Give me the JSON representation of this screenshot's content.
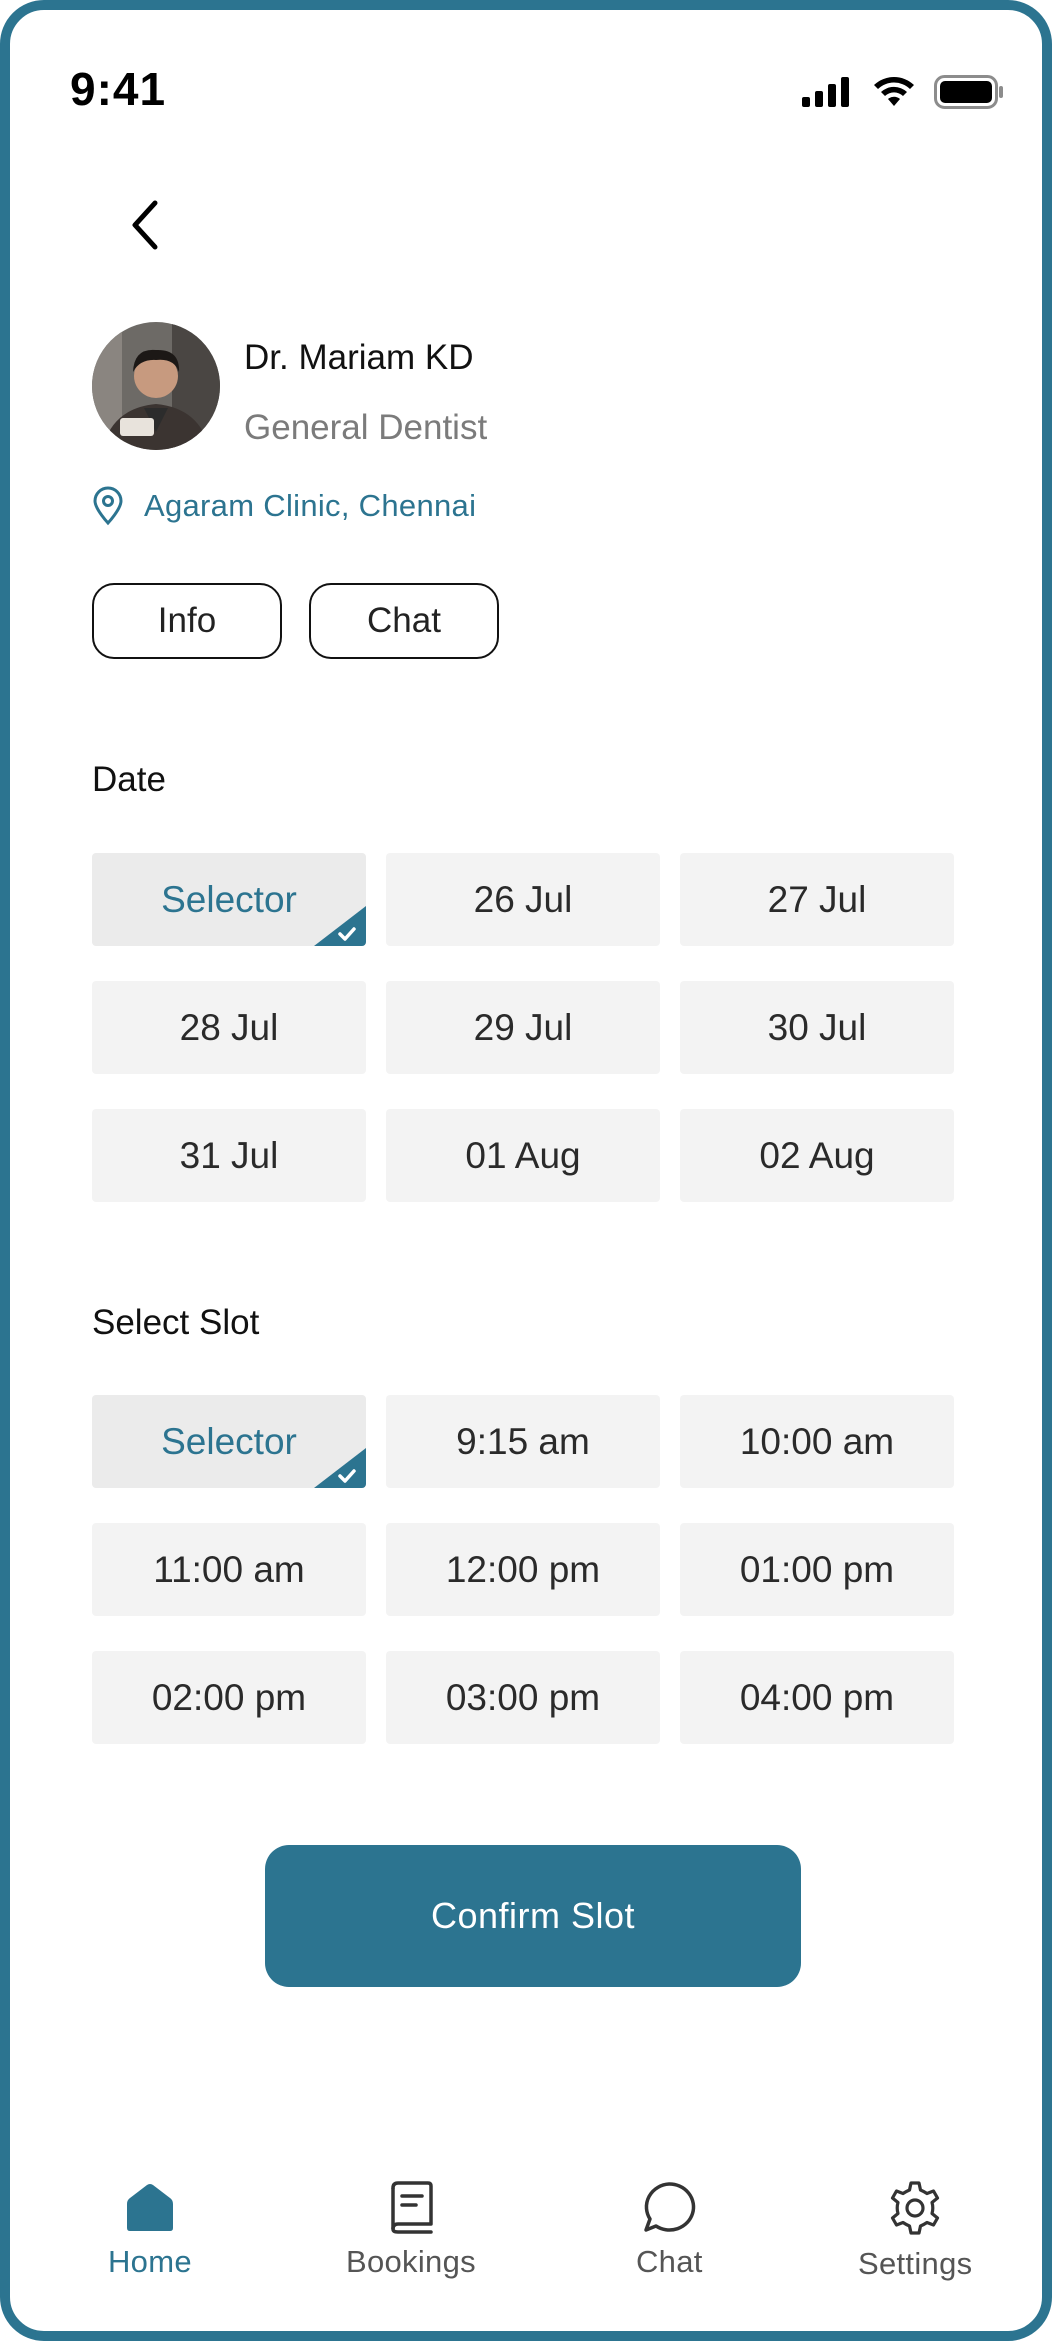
{
  "status_bar": {
    "time": "9:41"
  },
  "doctor": {
    "name": "Dr. Mariam KD",
    "specialty": "General Dentist",
    "location": "Agaram Clinic, Chennai"
  },
  "actions": {
    "info_label": "Info",
    "chat_label": "Chat"
  },
  "date_section": {
    "title": "Date",
    "options": [
      {
        "label": "Selector",
        "selected": true
      },
      {
        "label": "26 Jul",
        "selected": false
      },
      {
        "label": "27 Jul",
        "selected": false
      },
      {
        "label": "28 Jul",
        "selected": false
      },
      {
        "label": "29 Jul",
        "selected": false
      },
      {
        "label": "30 Jul",
        "selected": false
      },
      {
        "label": "31 Jul",
        "selected": false
      },
      {
        "label": "01 Aug",
        "selected": false
      },
      {
        "label": "02 Aug",
        "selected": false
      }
    ]
  },
  "slot_section": {
    "title": "Select Slot",
    "options": [
      {
        "label": "Selector",
        "selected": true
      },
      {
        "label": "9:15 am",
        "selected": false
      },
      {
        "label": "10:00 am",
        "selected": false
      },
      {
        "label": "11:00 am",
        "selected": false
      },
      {
        "label": "12:00 pm",
        "selected": false
      },
      {
        "label": "01:00 pm",
        "selected": false
      },
      {
        "label": "02:00 pm",
        "selected": false
      },
      {
        "label": "03:00 pm",
        "selected": false
      },
      {
        "label": "04:00 pm",
        "selected": false
      }
    ]
  },
  "confirm_label": "Confirm Slot",
  "tabs": [
    {
      "label": "Home",
      "icon": "home-icon",
      "active": true
    },
    {
      "label": "Bookings",
      "icon": "bookings-icon",
      "active": false
    },
    {
      "label": "Chat",
      "icon": "chat-bubble-icon",
      "active": false
    },
    {
      "label": "Settings",
      "icon": "settings-icon",
      "active": false
    }
  ],
  "colors": {
    "accent": "#2c7490",
    "cell_bg": "#f3f3f3",
    "muted_text": "#7b7b7b"
  }
}
